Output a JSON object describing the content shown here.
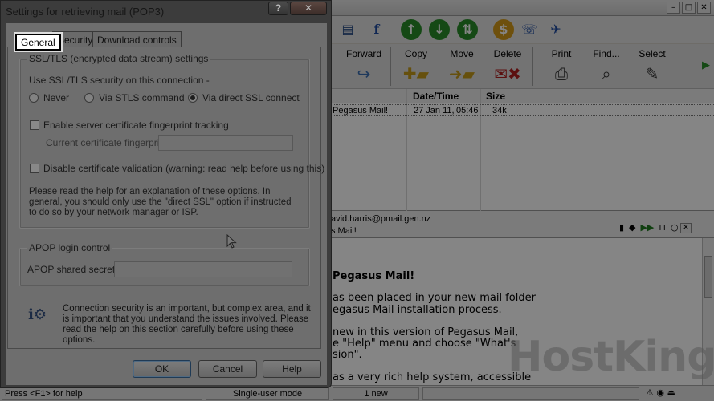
{
  "app": {
    "toolbar": {
      "forward": "Forward",
      "copy": "Copy",
      "move": "Move",
      "delete": "Delete",
      "print": "Print",
      "find": "Find...",
      "select": "Select"
    },
    "list": {
      "col_date": "Date/Time",
      "col_size": "Size",
      "row_from": "Pegasus Mail!",
      "row_date": "27 Jan 11,",
      "row_time": "05:46",
      "row_size": "34k"
    },
    "preview": {
      "from": "avid.harris@pmail.gen.nz",
      "subject": "s Mail!",
      "lines": [
        "Pegasus Mail!",
        "as been placed in your new mail folder",
        "egasus Mail installation process.",
        "new in this version of Pegasus Mail,",
        "e \"Help\" menu and choose \"What's",
        "sion\".",
        "as a very rich help system, accessible"
      ]
    },
    "status": {
      "help": "Press <F1> for help",
      "mode": "Single-user mode",
      "count": "1 new"
    },
    "watermark": "HostKing"
  },
  "dialog": {
    "title": "Settings for retrieving mail (POP3)",
    "help_btn": "?",
    "close_btn": "✕",
    "tabs": [
      "General",
      "Security",
      "Download controls"
    ],
    "ssl_group": "SSL/TLS (encrypted data stream) settings",
    "ssl_prompt": "Use SSL/TLS security on this connection -",
    "radio_never": "Never",
    "radio_stls": "Via STLS command",
    "radio_direct": "Via direct SSL connect",
    "selected_radio": "direct",
    "chk_fingerprint": "Enable server certificate fingerprint tracking",
    "fingerprint_label": "Current certificate fingerprint:",
    "fingerprint_value": "",
    "chk_disable_validation": "Disable certificate validation (warning: read help before using this)",
    "help_text": "Please read the help for an explanation of these options. In general, you should only use the \"direct SSL\" option if instructed to do so by your network manager or ISP.",
    "apop_group": "APOP login control",
    "apop_label": "APOP shared secret:",
    "apop_value": "",
    "notice": "Connection security is an important, but complex area, and it is important that you understand the issues involved. Please read the help on this section carefully before using these options.",
    "ok": "OK",
    "cancel": "Cancel",
    "help": "Help"
  }
}
